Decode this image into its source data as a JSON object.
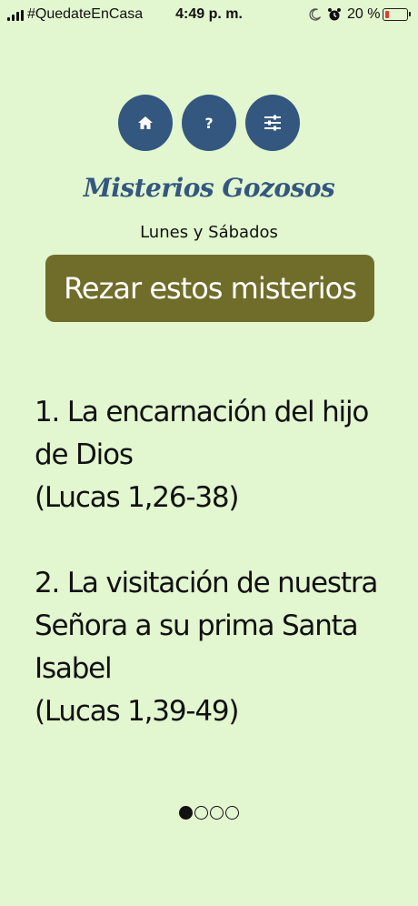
{
  "status_bar": {
    "carrier": "#QuedateEnCasa",
    "time": "4:49 p. m.",
    "battery_percent": "20 %",
    "battery_level": 0.2,
    "icons": [
      "signal-icon",
      "moon-icon",
      "alarm-icon",
      "battery-icon"
    ]
  },
  "nav": {
    "home_icon": "home-icon",
    "help_label": "?",
    "settings_icon": "sliders-icon",
    "color": "#33577f"
  },
  "header": {
    "title": "Misterios Gozosos",
    "subtitle": "Lunes y Sábados"
  },
  "pray_button": {
    "label": "Rezar estos misterios",
    "color": "#706d2a"
  },
  "mysteries": [
    {
      "text": "1. La encarnación del hijo de Dios",
      "reference": "(Lucas 1,26-38)"
    },
    {
      "text": "2. La visitación de nuestra Señora a su prima Santa Isabel",
      "reference": "(Lucas 1,39-49)"
    }
  ],
  "pagination": {
    "total": 4,
    "current": 1
  },
  "colors": {
    "background": "#e2f6cf",
    "accent": "#33577f"
  }
}
